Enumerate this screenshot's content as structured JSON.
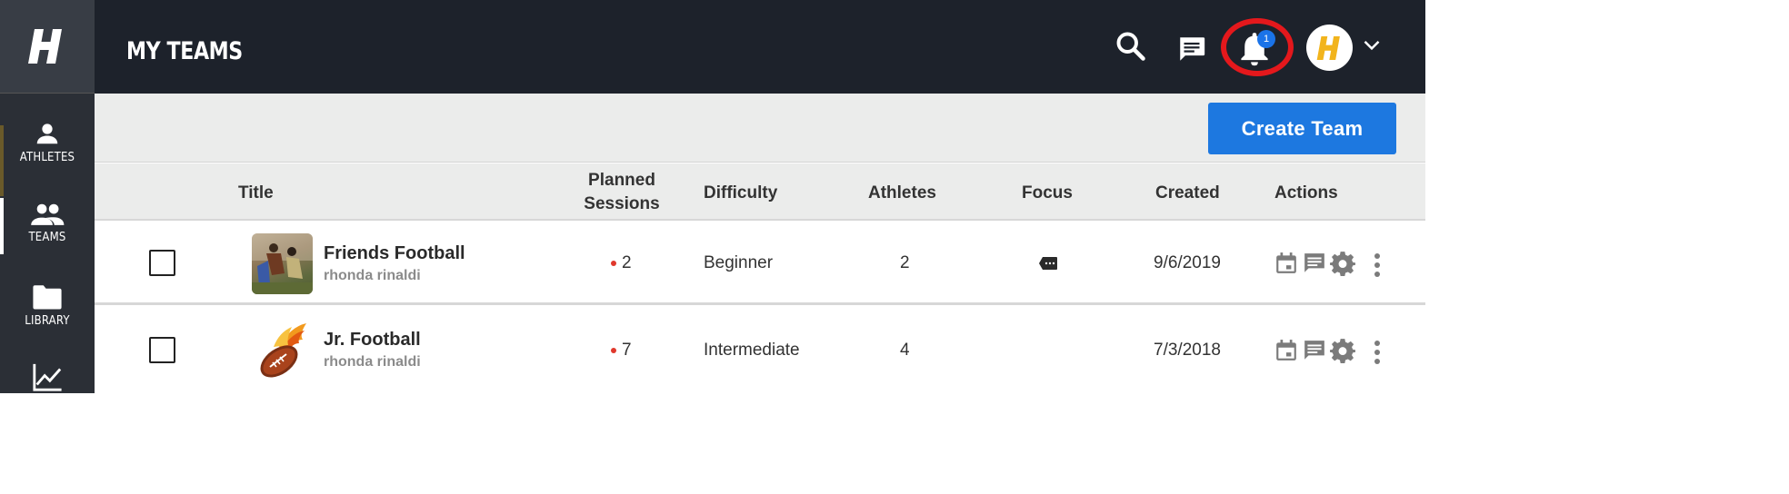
{
  "sidebar": {
    "items": [
      {
        "label": "ATHLETES",
        "icon": "person-icon"
      },
      {
        "label": "TEAMS",
        "icon": "group-icon"
      },
      {
        "label": "LIBRARY",
        "icon": "folder-icon"
      },
      {
        "label": "",
        "icon": "chart-icon"
      }
    ]
  },
  "header": {
    "title": "MY TEAMS",
    "notification_count": "1"
  },
  "toolbar": {
    "create_label": "Create Team"
  },
  "table": {
    "columns": {
      "title": "Title",
      "planned_line1": "Planned",
      "planned_line2": "Sessions",
      "difficulty": "Difficulty",
      "athletes": "Athletes",
      "focus": "Focus",
      "created": "Created",
      "actions": "Actions"
    },
    "rows": [
      {
        "name": "Friends Football",
        "owner": "rhonda rinaldi",
        "sessions": "2",
        "difficulty": "Beginner",
        "athletes": "2",
        "created": "9/6/2019"
      },
      {
        "name": "Jr. Football",
        "owner": "rhonda rinaldi",
        "sessions": "7",
        "difficulty": "Intermediate",
        "athletes": "4",
        "created": "7/3/2018"
      }
    ]
  },
  "colors": {
    "accent": "#1d78e0",
    "brand_yellow": "#f2b41c",
    "header_bg": "#1d222b",
    "sidebar_bg": "#2b2f36",
    "highlight": "#e4181c"
  }
}
